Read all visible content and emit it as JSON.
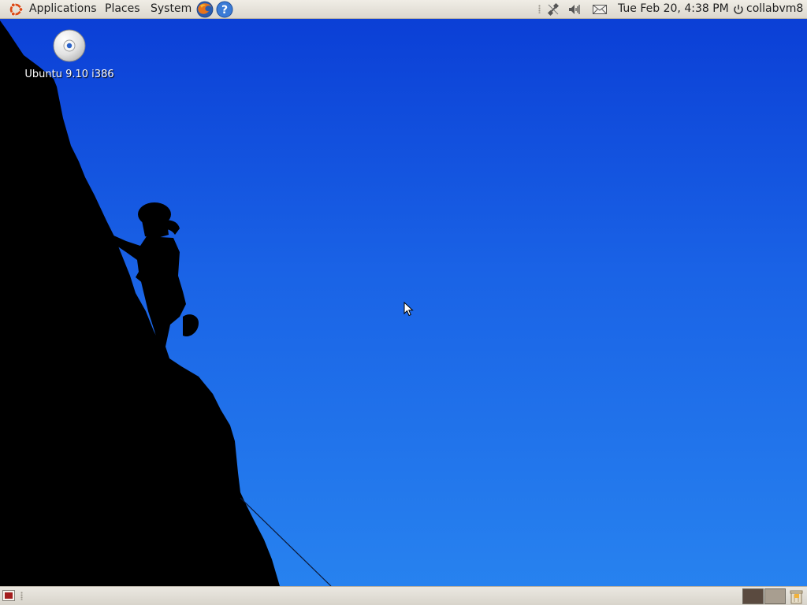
{
  "top_panel": {
    "menus": [
      {
        "label": "Applications"
      },
      {
        "label": "Places"
      },
      {
        "label": "System"
      }
    ],
    "launchers": [
      "firefox-icon",
      "help-icon"
    ],
    "tray_icons": [
      "network-disconnected-icon",
      "volume-icon",
      "mail-icon"
    ],
    "clock": "Tue Feb 20,  4:38 PM",
    "user": "collabvm8"
  },
  "desktop": {
    "icons": [
      {
        "label": "Ubuntu 9.10 i386",
        "icon": "cd-disc-icon"
      }
    ],
    "background_color": "#1a63e6"
  },
  "bottom_panel": {
    "workspaces": 2,
    "items": [
      "show-desktop-icon",
      "workspace-switcher",
      "trash-icon"
    ]
  }
}
